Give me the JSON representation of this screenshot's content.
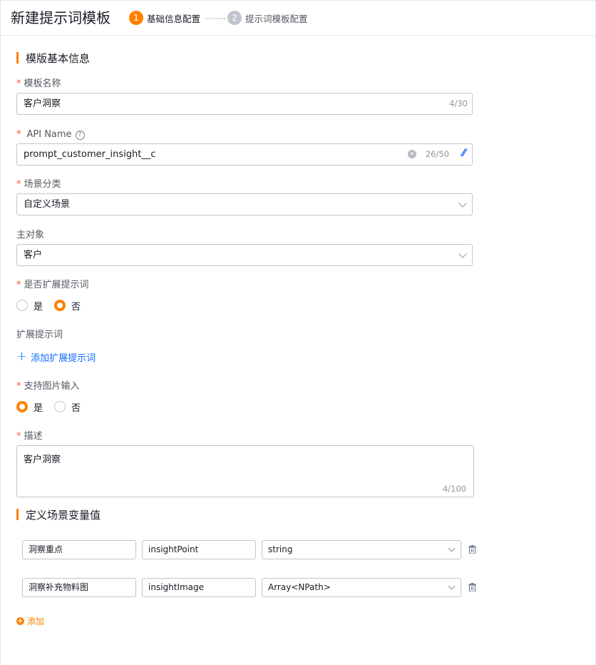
{
  "header": {
    "title": "新建提示词模板",
    "steps": [
      {
        "num": "1",
        "label": "基础信息配置"
      },
      {
        "num": "2",
        "label": "提示词模板配置"
      }
    ]
  },
  "sections": {
    "basic": "模版基本信息",
    "vars": "定义场景变量值"
  },
  "form": {
    "template_name": {
      "label": "模板名称",
      "value": "客户洞察",
      "counter": "4/30"
    },
    "api_name": {
      "label": "API Name",
      "value": "prompt_customer_insight__c",
      "counter": "26/50"
    },
    "scene": {
      "label": "场景分类",
      "value": "自定义场景"
    },
    "main_object": {
      "label": "主对象",
      "value": "客户"
    },
    "extend_prompt": {
      "label": "是否扩展提示词",
      "options": [
        "是",
        "否"
      ],
      "selected": "否"
    },
    "extend_words": {
      "label": "扩展提示词",
      "add_label": "添加扩展提示词"
    },
    "image_input": {
      "label": "支持图片输入",
      "options": [
        "是",
        "否"
      ],
      "selected": "是"
    },
    "description": {
      "label": "描述",
      "value": "客户洞察",
      "counter": "4/100"
    }
  },
  "variables": [
    {
      "name": "洞察重点",
      "api": "insightPoint",
      "type": "string"
    },
    {
      "name": "洞察补充物料图",
      "api": "insightImage",
      "type": "Array<NPath>"
    }
  ],
  "add_variable_label": "添加",
  "colors": {
    "accent": "#ff8000",
    "link": "#0c6cff",
    "required": "#ff522a"
  }
}
